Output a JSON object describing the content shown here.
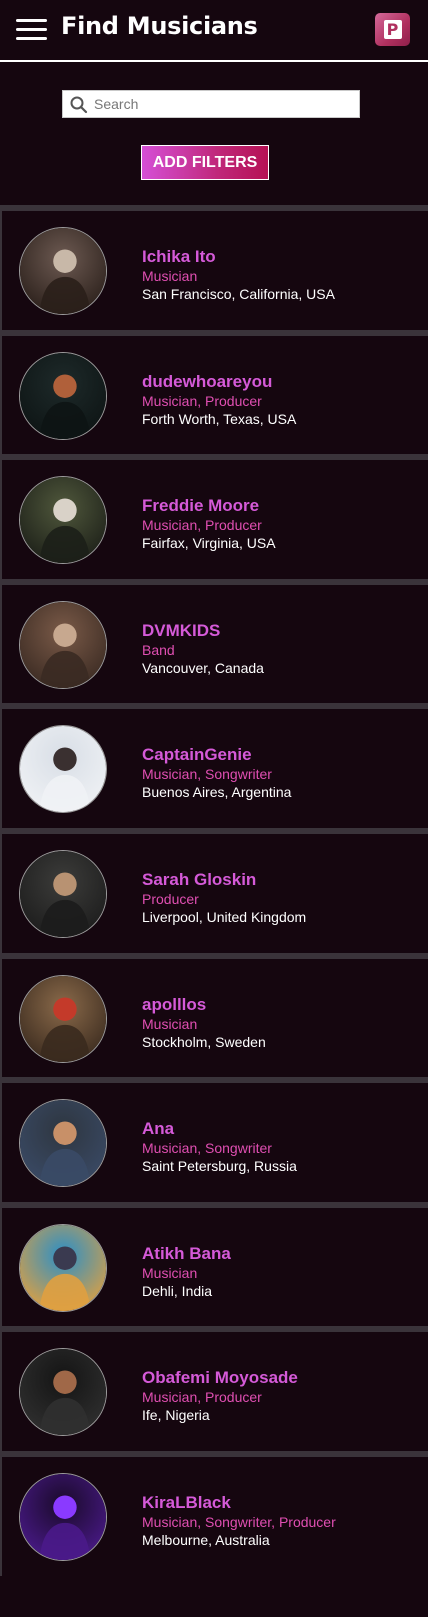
{
  "header": {
    "title": "Find Musicians",
    "logo_letter": "P"
  },
  "search": {
    "placeholder": "Search",
    "value": ""
  },
  "filters_button": "ADD FILTERS",
  "colors": {
    "background": "#15060f",
    "accent_pink": "#d55ad8",
    "role_pink": "#e04fb2",
    "divider": "#3a333a"
  },
  "musicians": [
    {
      "name": "Ichika Ito",
      "roles": "Musician",
      "location": "San Francisco, California, USA"
    },
    {
      "name": "dudewhoareyou",
      "roles": "Musician, Producer",
      "location": "Forth Worth, Texas, USA"
    },
    {
      "name": "Freddie Moore",
      "roles": "Musician, Producer",
      "location": "Fairfax, Virginia, USA"
    },
    {
      "name": "DVMKIDS",
      "roles": "Band",
      "location": "Vancouver, Canada"
    },
    {
      "name": "CaptainGenie",
      "roles": "Musician, Songwriter",
      "location": "Buenos Aires, Argentina"
    },
    {
      "name": "Sarah Gloskin",
      "roles": "Producer",
      "location": "Liverpool, United Kingdom"
    },
    {
      "name": "apolllos",
      "roles": "Musician",
      "location": "Stockholm, Sweden"
    },
    {
      "name": "Ana",
      "roles": "Musician, Songwriter",
      "location": "Saint Petersburg, Russia"
    },
    {
      "name": "Atikh Bana",
      "roles": "Musician",
      "location": "Dehli, India"
    },
    {
      "name": "Obafemi Moyosade",
      "roles": "Musician, Producer",
      "location": "Ife, Nigeria"
    },
    {
      "name": "KiraLBlack",
      "roles": "Musician, Songwriter, Producer",
      "location": "Melbourne, Australia"
    }
  ]
}
